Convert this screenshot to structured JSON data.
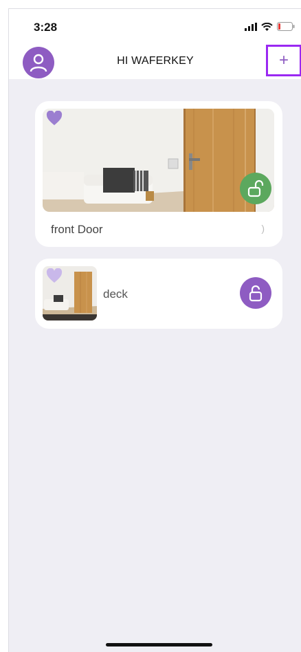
{
  "status_bar": {
    "time": "3:28"
  },
  "header": {
    "title": "HI WAFERKEY",
    "add_label": "+"
  },
  "locks": [
    {
      "name": "front Door",
      "favorite": true,
      "status": "unlocked",
      "badge_color": "#5ca85e",
      "chevron": ")"
    },
    {
      "name": "deck",
      "favorite": true,
      "status": "unlocked",
      "badge_color": "#8e5cc2"
    }
  ],
  "colors": {
    "accent": "#8e5cc2",
    "unlocked_green": "#5ca85e",
    "highlight": "#9a28f2",
    "background": "#efeef4"
  }
}
